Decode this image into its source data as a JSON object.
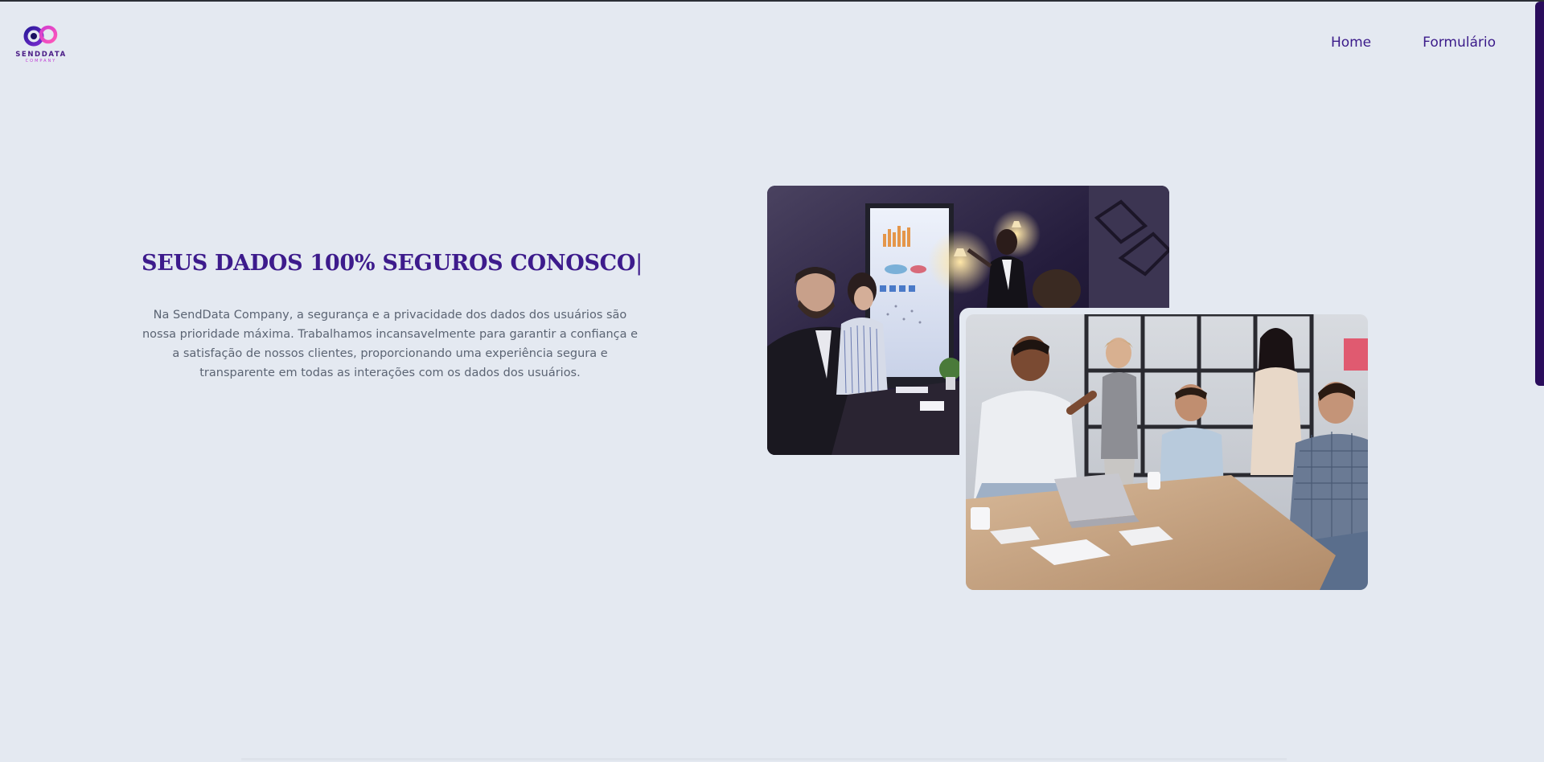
{
  "brand": {
    "name": "SENDDATA",
    "tagline": "COMPANY"
  },
  "nav": {
    "items": [
      {
        "label": "Home"
      },
      {
        "label": "Formulário"
      }
    ]
  },
  "hero": {
    "title": "SEUS DADOS 100% SEGUROS CONOSCO",
    "caret": "|",
    "description": "Na SendData Company, a segurança e a privacidade dos dados dos usuários são nossa prioridade máxima. Trabalhamos incansavelmente para garantir a confiança e a satisfação de nossos clientes, proporcionando uma experiência segura e transparente em todas as interações com os dados dos usuários."
  },
  "colors": {
    "background": "#e4e9f1",
    "accent": "#3d1b8c",
    "scrollbar": "#2a0d5c",
    "logo_pink": "#e040c8",
    "logo_blue": "#3a1aa0"
  },
  "icons": {
    "logo": "infinity-logo-icon"
  }
}
